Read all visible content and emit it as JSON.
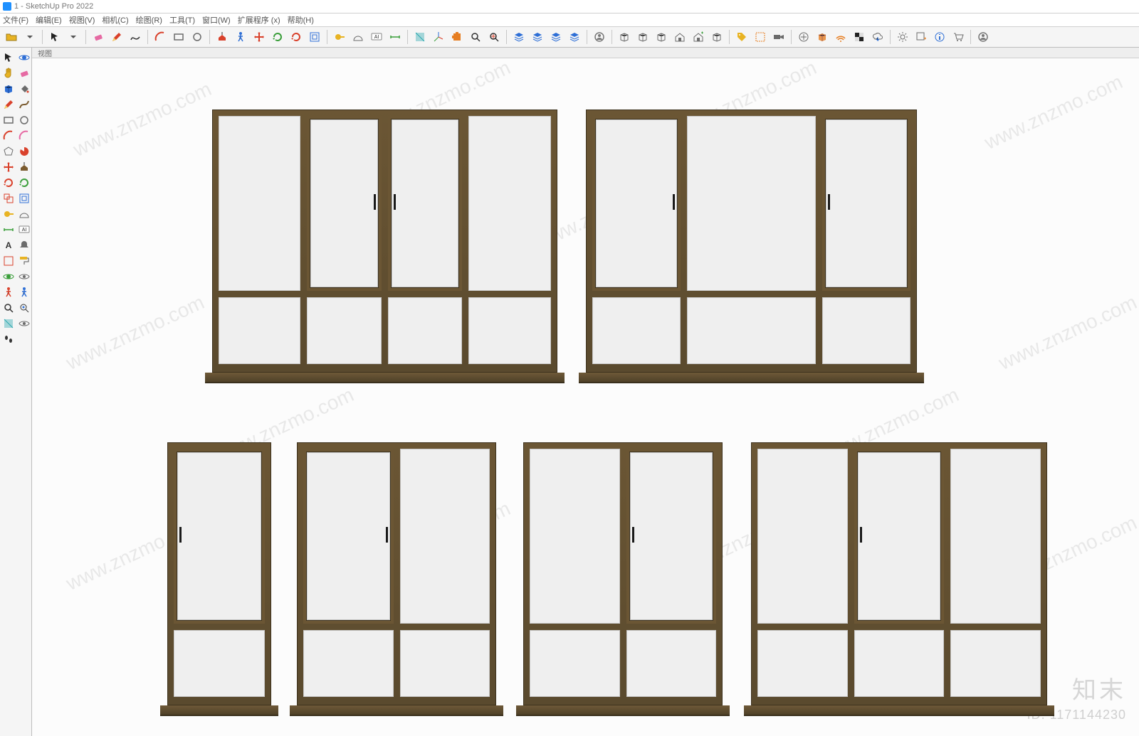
{
  "app": {
    "title": "1 - SketchUp Pro 2022"
  },
  "menu": {
    "items": [
      "文件(F)",
      "编辑(E)",
      "视图(V)",
      "相机(C)",
      "绘图(R)",
      "工具(T)",
      "窗口(W)",
      "扩展程序 (x)",
      "帮助(H)"
    ]
  },
  "scene": {
    "label": "视图"
  },
  "watermark": {
    "brand": "知末",
    "id_label": "ID: 1171144230",
    "repeat_text": "www.znzmo.com"
  },
  "icons": {
    "top": [
      "folder-open",
      "dropdown",
      "sep",
      "select-arrow",
      "dropdown",
      "sep",
      "eraser-pink",
      "pencil",
      "freehand",
      "sep",
      "arc",
      "rectangle",
      "circle",
      "sep",
      "pushpull-red",
      "walk-blue",
      "move-red",
      "rotate-green",
      "rotate-loop",
      "offset",
      "sep",
      "tape",
      "protractor",
      "label-ai",
      "dimension",
      "sep",
      "section-cyan",
      "axes",
      "extension",
      "zoom",
      "zoom-extents",
      "sep",
      "layer-stack",
      "add-layer",
      "layer-visibility",
      "layer-toggle",
      "sep",
      "user-circle",
      "sep",
      "box",
      "box-front",
      "box-iso",
      "house",
      "house-plus",
      "cabinet",
      "sep",
      "tag-yellow",
      "select-box",
      "video-camera",
      "sep",
      "plus-circle",
      "cube-3d",
      "wifi-orange",
      "checker",
      "cloud-down",
      "sep",
      "gear",
      "window-plus",
      "info",
      "cart",
      "sep",
      "profile-circle"
    ],
    "left": [
      "select-arrow",
      "orbit-blue",
      "hand-yellow",
      "eraser-large",
      "blue-cube",
      "paint-bucket",
      "pencil-red",
      "curve-brown",
      "rectangle-gray",
      "circle-gray",
      "arc-red",
      "arc-pink",
      "polygon",
      "pie",
      "move-red",
      "pushpull-brown",
      "rotate-red",
      "rotate-green",
      "scale-red",
      "offset-blue",
      "tape-yellow",
      "protractor-gray",
      "dimension-green",
      "label-ai",
      "text-a",
      "bell",
      "select-red",
      "paint-roller",
      "orbit-green",
      "eye",
      "walk-red",
      "walk-blue",
      "zoom-red",
      "position-camera",
      "section-blue",
      "look-around",
      "footprints",
      "blank"
    ]
  },
  "colors": {
    "wood": "#6b5634",
    "glass": "#efefef"
  }
}
